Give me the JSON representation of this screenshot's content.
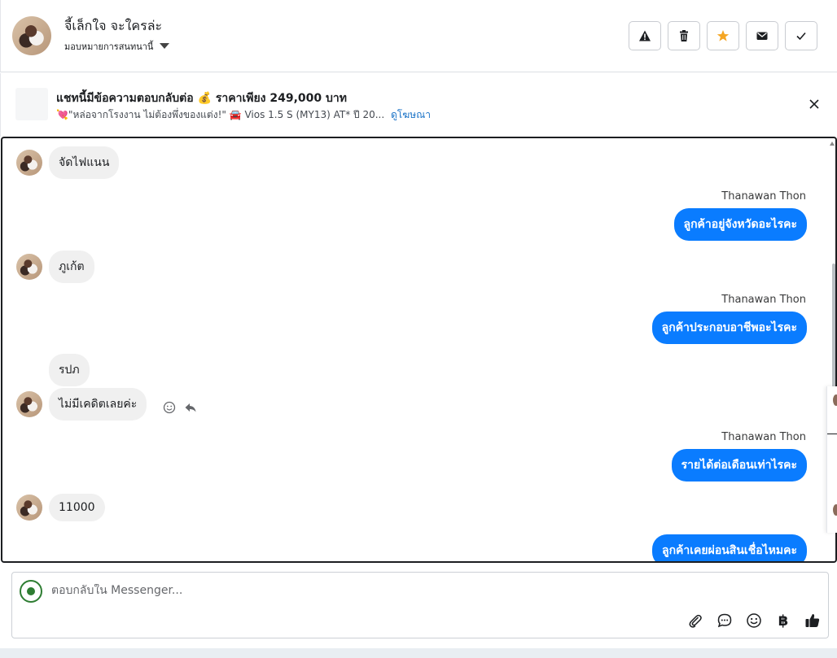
{
  "header": {
    "contact_name": "จี้เล็กใจ จะใครล่ะ",
    "assign_label": "มอบหมายการสนทนานี้",
    "actions": [
      {
        "icon": "warning-icon"
      },
      {
        "icon": "trash-icon"
      },
      {
        "icon": "star-icon"
      },
      {
        "icon": "mail-icon"
      },
      {
        "icon": "check-icon"
      }
    ],
    "colors": {
      "star": "#f5a623"
    }
  },
  "ad": {
    "title": "แชทนี้มีข้อความตอบกลับต่อ 💰 ราคาเพียง 249,000 บาท",
    "subtitle": "💘\"หล่อจากโรงงาน ไม่ต้องพึ่งของแต่ง!\" 🚘 Vios 1.5 S (MY13) AT* ปี 20...",
    "link": "ดูโฆษณา"
  },
  "messages": [
    {
      "dir": "in",
      "text": "จัดไฟแนน"
    },
    {
      "dir": "out",
      "sender": "Thanawan Thon",
      "text": "ลูกค้าอยู่จังหวัดอะไรคะ"
    },
    {
      "dir": "in",
      "text": "ภูเก้ต"
    },
    {
      "dir": "out",
      "sender": "Thanawan Thon",
      "text": "ลูกค้าประกอบอาชีพอะไรคะ"
    },
    {
      "dir": "in",
      "text": "รปภ"
    },
    {
      "dir": "in",
      "text": "ไม่มีเคดิตเลยค่ะ"
    },
    {
      "dir": "out",
      "sender": "Thanawan Thon",
      "text": "รายได้ต่อเดือนเท่าไรคะ"
    },
    {
      "dir": "in",
      "text": "11000"
    },
    {
      "dir": "out",
      "text": "ลูกค้าเคยผ่อนสินเชื่อไหมคะ"
    }
  ],
  "composer": {
    "placeholder": "ตอบกลับใน Messenger...",
    "baht_symbol": "฿"
  },
  "colors": {
    "outgoing_bubble": "#0a7cff",
    "incoming_bubble": "#f0f0f0"
  }
}
